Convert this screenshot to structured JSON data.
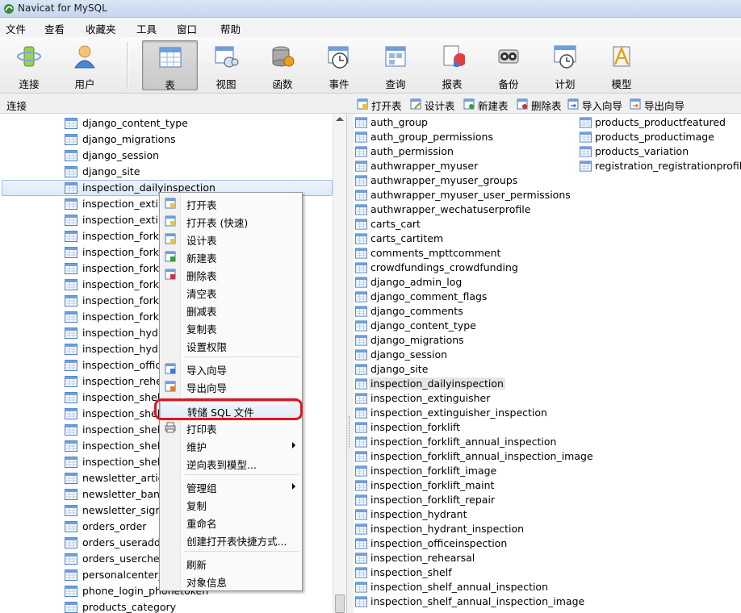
{
  "window": {
    "title": "Navicat for MySQL"
  },
  "menu": [
    "文件",
    "查看",
    "收藏夹",
    "工具",
    "窗口",
    "帮助"
  ],
  "toolbar": [
    {
      "label": "连接",
      "icon": "connection-icon",
      "active": false
    },
    {
      "label": "用户",
      "icon": "user-icon",
      "active": false
    },
    {
      "label": "表",
      "icon": "table-icon",
      "active": true
    },
    {
      "label": "视图",
      "icon": "view-icon",
      "active": false
    },
    {
      "label": "函数",
      "icon": "function-icon",
      "active": false
    },
    {
      "label": "事件",
      "icon": "event-icon",
      "active": false
    },
    {
      "label": "查询",
      "icon": "query-icon",
      "active": false
    },
    {
      "label": "报表",
      "icon": "report-icon",
      "active": false
    },
    {
      "label": "备份",
      "icon": "backup-icon",
      "active": false
    },
    {
      "label": "计划",
      "icon": "schedule-icon",
      "active": false
    },
    {
      "label": "模型",
      "icon": "model-icon",
      "active": false
    }
  ],
  "status": {
    "connection_label": "连接"
  },
  "object_toolbar": [
    "打开表",
    "设计表",
    "新建表",
    "删除表",
    "导入向导",
    "导出向导"
  ],
  "tree": {
    "items": [
      "django_content_type",
      "django_migrations",
      "django_session",
      "django_site",
      "inspection_dailyinspection",
      "inspection_exting",
      "inspection_exting",
      "inspection_forkli",
      "inspection_forkli",
      "inspection_forkli",
      "inspection_forkli",
      "inspection_forkli",
      "inspection_forkli",
      "inspection_hydra",
      "inspection_hydra",
      "inspection_office",
      "inspection_rehea",
      "inspection_shelf",
      "inspection_shel",
      "inspection_shelf_",
      "inspection_shelf_",
      "inspection_shelf_",
      "newsletter_article",
      "newsletter_banne",
      "newsletter_signu",
      "orders_order",
      "orders_useradd",
      "orders_userche",
      "personalcenter_",
      "phone_login_phonetoken",
      "products_category"
    ],
    "selected_index": 4
  },
  "table_list": {
    "col1": [
      "auth_group",
      "auth_group_permissions",
      "auth_permission",
      "authwrapper_myuser",
      "authwrapper_myuser_groups",
      "authwrapper_myuser_user_permissions",
      "authwrapper_wechatuserprofile",
      "carts_cart",
      "carts_cartitem",
      "comments_mpttcomment",
      "crowdfundings_crowdfunding",
      "django_admin_log",
      "django_comment_flags",
      "django_comments",
      "django_content_type",
      "django_migrations",
      "django_session",
      "django_site",
      "inspection_dailyinspection",
      "inspection_extinguisher",
      "inspection_extinguisher_inspection",
      "inspection_forklift",
      "inspection_forklift_annual_inspection",
      "inspection_forklift_annual_inspection_image",
      "inspection_forklift_image",
      "inspection_forklift_maint",
      "inspection_forklift_repair",
      "inspection_hydrant",
      "inspection_hydrant_inspection",
      "inspection_officeinspection",
      "inspection_rehearsal",
      "inspection_shelf",
      "inspection_shelf_annual_inspection",
      "inspection_shelf_annual_inspection_image"
    ],
    "col2": [
      "products_productfeatured",
      "products_productimage",
      "products_variation",
      "registration_registrationprofile"
    ],
    "selected": "inspection_dailyinspection"
  },
  "context_menu": [
    {
      "label": "打开表",
      "icon": "open-table-icon"
    },
    {
      "label": "打开表 (快速)",
      "icon": "open-table-fast-icon"
    },
    {
      "label": "设计表",
      "icon": "design-table-icon"
    },
    {
      "label": "新建表",
      "icon": "new-table-icon"
    },
    {
      "label": "删除表",
      "icon": "delete-table-icon"
    },
    {
      "label": "清空表",
      "icon": ""
    },
    {
      "label": "删减表",
      "icon": ""
    },
    {
      "label": "复制表",
      "icon": ""
    },
    {
      "label": "设置权限",
      "icon": ""
    },
    {
      "sep": true
    },
    {
      "label": "导入向导",
      "icon": "import-wizard-icon"
    },
    {
      "label": "导出向导",
      "icon": "export-wizard-icon"
    },
    {
      "sep": true
    },
    {
      "label": "转储 SQL 文件",
      "icon": "",
      "highlight": true
    },
    {
      "label": "打印表",
      "icon": "print-icon"
    },
    {
      "label": "维护",
      "icon": "",
      "submenu": true
    },
    {
      "label": "逆向表到模型...",
      "icon": ""
    },
    {
      "sep": true
    },
    {
      "label": "管理组",
      "icon": "",
      "submenu": true
    },
    {
      "label": "复制",
      "icon": ""
    },
    {
      "label": "重命名",
      "icon": ""
    },
    {
      "label": "创建打开表快捷方式...",
      "icon": ""
    },
    {
      "sep": true
    },
    {
      "label": "刷新",
      "icon": ""
    },
    {
      "label": "对象信息",
      "icon": ""
    }
  ],
  "colors": {
    "annotation": "#e0161d",
    "selection": "#dbe9f9"
  }
}
